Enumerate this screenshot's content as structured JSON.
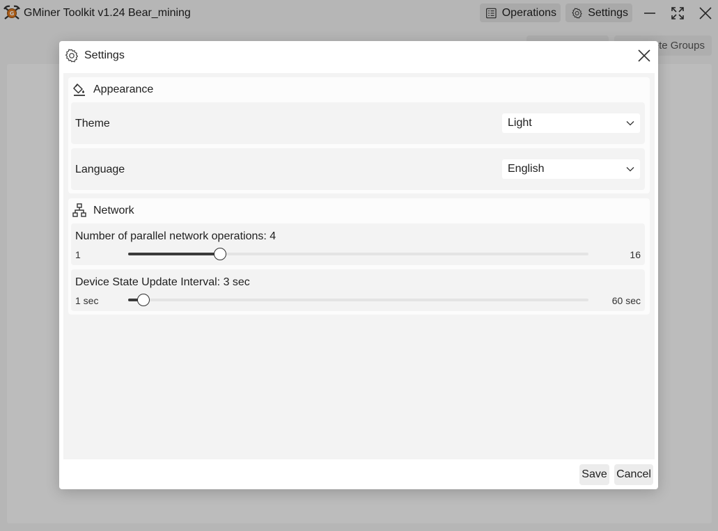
{
  "window": {
    "title": "GMiner Toolkit v1.24 Bear_mining",
    "operations_label": "Operations",
    "settings_label": "Settings"
  },
  "background": {
    "toolbar_btn_1": "",
    "toolbar_btn_2": "ete Groups"
  },
  "dialog": {
    "title": "Settings",
    "save_label": "Save",
    "cancel_label": "Cancel",
    "appearance": {
      "title": "Appearance",
      "theme_label": "Theme",
      "theme_value": "Light",
      "language_label": "Language",
      "language_value": "English"
    },
    "network": {
      "title": "Network",
      "parallel": {
        "label": "Number of parallel network operations:",
        "value": "4",
        "value_num": 4,
        "min": 1,
        "max": 16,
        "min_label": "1",
        "max_label": "16"
      },
      "interval": {
        "label": "Device State Update Interval:",
        "value": "3 sec",
        "value_num": 3,
        "min": 1,
        "max": 60,
        "min_label": "1 sec",
        "max_label": "60 sec"
      }
    }
  },
  "colors": {
    "accent": "#2e2e2e",
    "logo_orange": "#e07a1f"
  },
  "icons": {
    "app_logo": "miner-pickaxe-logo-icon",
    "operations": "list-icon",
    "settings": "gear-icon",
    "appearance": "paint-bucket-icon",
    "network": "network-icon"
  }
}
